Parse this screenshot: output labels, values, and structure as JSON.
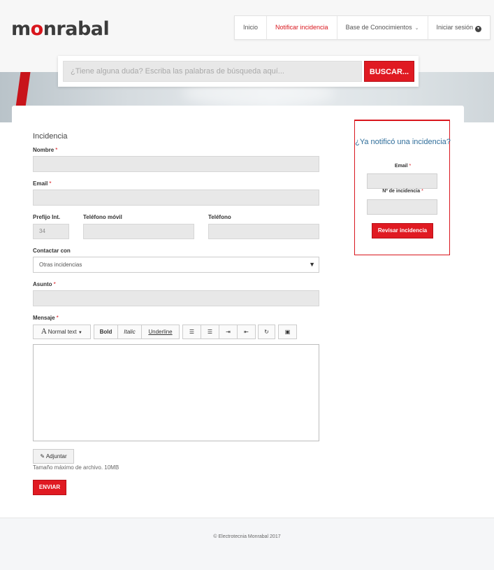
{
  "brand": {
    "logo_pre": "m",
    "logo_o": "o",
    "logo_post": "nrabal",
    "accent": "#d9161d"
  },
  "nav": {
    "items": [
      {
        "label": "Inicio"
      },
      {
        "label": "Notificar incidencia",
        "active": true
      },
      {
        "label": "Base de Conocimientos"
      },
      {
        "label": "Iniciar sesión"
      }
    ]
  },
  "search": {
    "placeholder": "¿Tiene alguna duda? Escriba las palabras de búsqueda aquí...",
    "button": "BUSCAR..."
  },
  "form": {
    "title": "Incidencia",
    "nombre_label": "Nombre",
    "email_label": "Email",
    "prefijo_label": "Prefijo Int.",
    "prefijo_value": "34",
    "movil_label": "Teléfono móvil",
    "telefono_label": "Teléfono",
    "contactar_label": "Contactar con",
    "contactar_value": "Otras incidencias",
    "asunto_label": "Asunto",
    "mensaje_label": "Mensaje",
    "required_mark": "*",
    "toolbar": {
      "font_icon": "A",
      "normal_text": "Normal text",
      "bold": "Bold",
      "italic": "Italic",
      "underline": "Underline"
    },
    "attach_label": "Adjuntar",
    "attach_note": "Tamaño máximo de archivo. 10MB",
    "submit": "ENVIAR"
  },
  "side": {
    "title": "¿Ya notificó una incidencia?",
    "email_label": "Email",
    "num_label": "Nº de incidencia",
    "required_mark": "*",
    "button": "Revisar incidencia"
  },
  "footer": {
    "text": "© Electrotecnia Monrabal 2017"
  }
}
